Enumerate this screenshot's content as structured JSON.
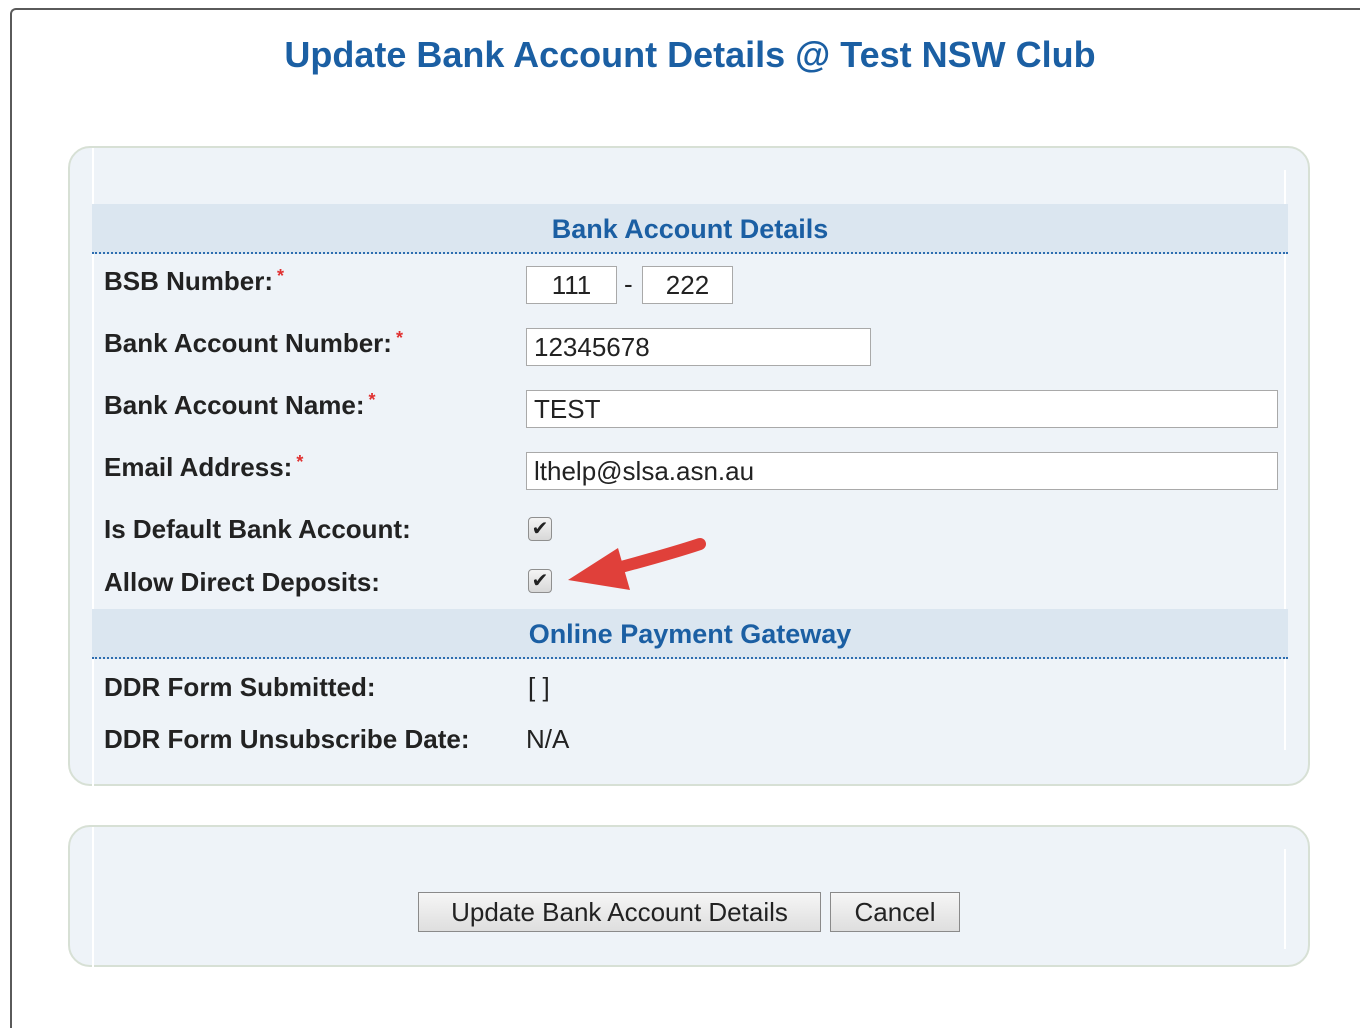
{
  "page": {
    "title": "Update Bank Account Details @ Test NSW Club"
  },
  "bank_section": {
    "header": "Bank Account Details",
    "bsb": {
      "label": "BSB Number:",
      "part1": "111",
      "separator": "-",
      "part2": "222"
    },
    "account_number": {
      "label": "Bank Account Number:",
      "value": "12345678"
    },
    "account_name": {
      "label": "Bank Account Name:",
      "value": "TEST"
    },
    "email": {
      "label": "Email Address:",
      "value": "lthelp@slsa.asn.au"
    },
    "is_default": {
      "label": "Is Default Bank Account:",
      "checked": true
    },
    "allow_direct_deposits": {
      "label": "Allow Direct Deposits:",
      "checked": true
    },
    "required_marker": "*",
    "check_glyph": "✔"
  },
  "gateway_section": {
    "header": "Online Payment Gateway",
    "ddr_submitted": {
      "label": "DDR Form Submitted:",
      "value": "[  ]"
    },
    "ddr_unsubscribe": {
      "label": "DDR Form Unsubscribe Date:",
      "value": "N/A"
    }
  },
  "actions": {
    "update_label": "Update Bank Account Details",
    "cancel_label": "Cancel"
  },
  "annotation": {
    "arrow_color": "#e0403a"
  }
}
